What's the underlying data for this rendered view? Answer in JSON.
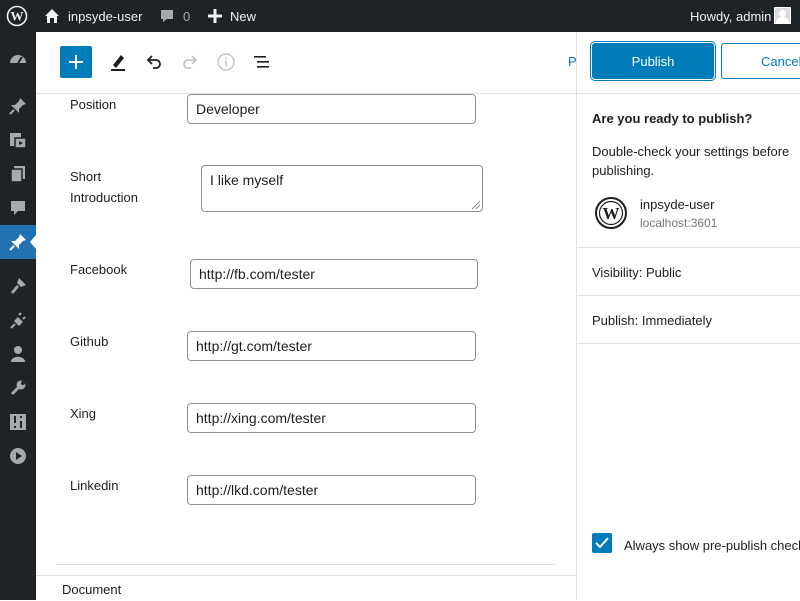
{
  "admin_bar": {
    "site_name": "inpsyde-user",
    "comments_count": "0",
    "new_label": "New",
    "howdy": "Howdy, admin"
  },
  "sidebar": {
    "items": [
      {
        "icon": "dashboard-icon"
      },
      {
        "icon": "posts-pin-icon"
      },
      {
        "icon": "media-icon"
      },
      {
        "icon": "pages-icon"
      },
      {
        "icon": "comments-icon"
      },
      {
        "icon": "pin-icon",
        "active": true
      },
      {
        "icon": "appearance-icon"
      },
      {
        "icon": "plugins-icon"
      },
      {
        "icon": "users-icon"
      },
      {
        "icon": "tools-icon"
      },
      {
        "icon": "settings-icon"
      },
      {
        "icon": "media-play-icon"
      }
    ]
  },
  "toolbar": {
    "preview_peek": "P"
  },
  "form": {
    "position": {
      "label": "Position",
      "value": "Developer"
    },
    "intro": {
      "label_line1": "Short",
      "label_line2": "Introduction",
      "value": "I like myself"
    },
    "facebook": {
      "label": "Facebook",
      "value": "http://fb.com/tester"
    },
    "github": {
      "label": "Github",
      "value": "http://gt.com/tester"
    },
    "xing": {
      "label": "Xing",
      "value": "http://xing.com/tester"
    },
    "linkedin": {
      "label": "Linkedin",
      "value": "http://lkd.com/tester"
    }
  },
  "footer": {
    "document_label": "Document"
  },
  "publish_panel": {
    "publish_label": "Publish",
    "cancel_label": "Cancel",
    "title": "Are you ready to publish?",
    "description": "Double-check your settings before publishing.",
    "site_name": "inpsyde-user",
    "site_url": "localhost:3601",
    "visibility_key": "Visibility:",
    "visibility_value": "Public",
    "publish_key": "Publish:",
    "publish_value": "Immediately",
    "always_show_label": "Always show pre-publish checks.",
    "always_show_checked": true
  },
  "colors": {
    "admin_bar": "#1d2327",
    "accent": "#007cba",
    "sidebar_active": "#2271b1"
  }
}
